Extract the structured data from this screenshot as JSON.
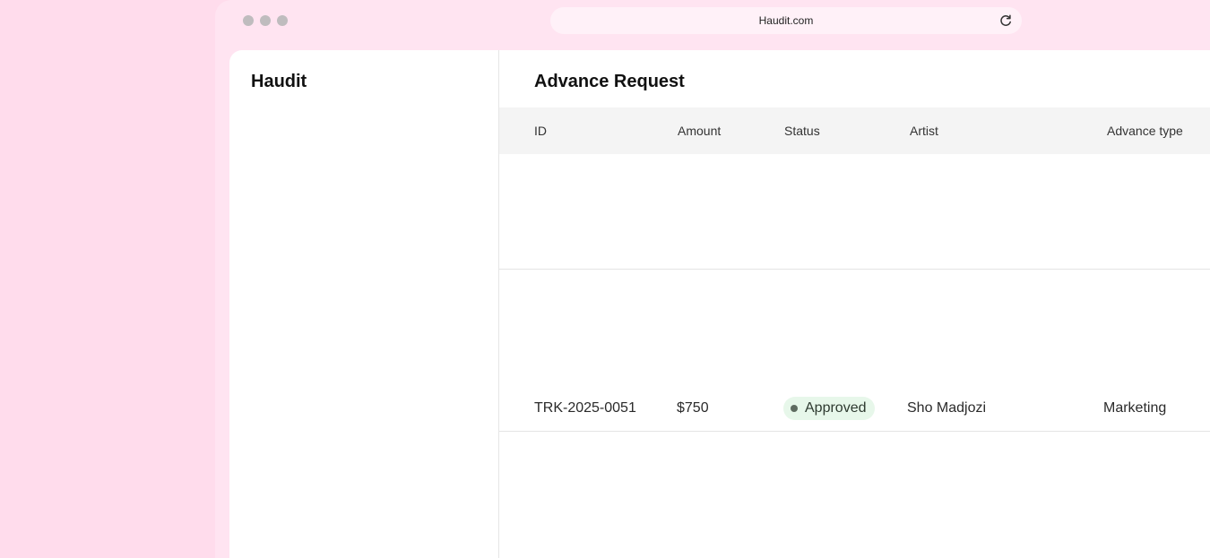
{
  "browser": {
    "url": "Haudit.com"
  },
  "sidebar": {
    "brand": "Haudit"
  },
  "main": {
    "title": "Advance Request",
    "columns": [
      "ID",
      "Amount",
      "Status",
      "Artist",
      "Advance type"
    ],
    "rows": [
      {
        "id": "TRK-2025-0051",
        "amount": "$750",
        "status": "Approved",
        "artist": "Sho Madjozi",
        "advance_type": "Marketing"
      }
    ]
  },
  "colors": {
    "background": "#ffdcec",
    "status_approved_bg": "#e7f7ea"
  },
  "icons": {
    "window_controls": [
      "window-close-icon",
      "window-minimize-icon",
      "window-maximize-icon"
    ],
    "reload": "reload-icon"
  }
}
